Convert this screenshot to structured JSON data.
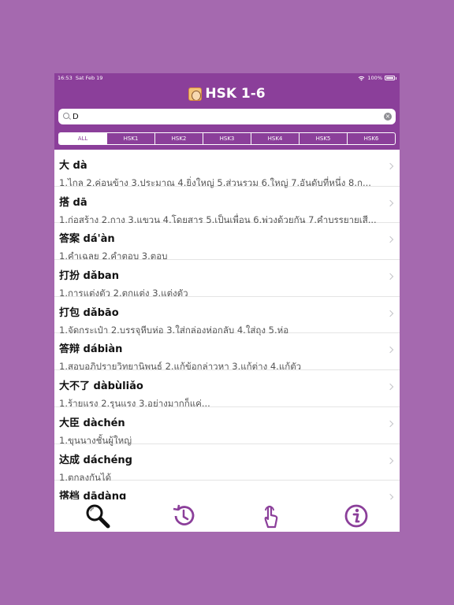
{
  "status_bar": {
    "time": "16:53",
    "date": "Sat Feb 19",
    "battery": "100%"
  },
  "header": {
    "title": "HSK 1-6"
  },
  "search": {
    "value": "D",
    "placeholder": ""
  },
  "segments": [
    "ALL",
    "HSK1",
    "HSK2",
    "HSK3",
    "HSK4",
    "HSK5",
    "HSK6"
  ],
  "selected_segment": "ALL",
  "words": [
    {
      "hanzi": "大",
      "pinyin": "dà",
      "meaning": "1.ไกล 2.ค่อนข้าง 3.ประมาณ 4.ยิ่งใหญ่ 5.ส่วนรวม 6.ใหญ่ 7.อันดับที่หนึ่ง 8.ก..."
    },
    {
      "hanzi": "搭",
      "pinyin": "dā",
      "meaning": "1.ก่อสร้าง 2.กาง 3.แขวน 4.โดยสาร 5.เป็นเพื่อน 6.พ่วงด้วยกัน 7.คำบรรยายเสี..."
    },
    {
      "hanzi": "答案",
      "pinyin": "dá'àn",
      "meaning": "1.คำเฉลย 2.คำตอบ 3.ตอบ"
    },
    {
      "hanzi": "打扮",
      "pinyin": "dǎban",
      "meaning": "1.การแต่งตัว 2.ตกแต่ง 3.แต่งตัว"
    },
    {
      "hanzi": "打包",
      "pinyin": "dǎbāo",
      "meaning": "1.จัดกระเป๋า 2.บรรจุหีบห่อ 3.ใส่กล่องห่อกลับ 4.ใส่ถุง 5.ห่อ"
    },
    {
      "hanzi": "答辩",
      "pinyin": "dábiàn",
      "meaning": "1.สอบอภิปรายวิทยานิพนธ์ 2.แก้ข้อกล่าวหา 3.แก้ต่าง 4.แก้ตัว"
    },
    {
      "hanzi": "大不了",
      "pinyin": "dàbùliǎo",
      "meaning": "1.ร้ายแรง 2.รุนแรง 3.อย่างมากก็แค่..."
    },
    {
      "hanzi": "大臣",
      "pinyin": "dàchén",
      "meaning": "1.ขุนนางชั้นผู้ใหญ่"
    },
    {
      "hanzi": "达成",
      "pinyin": "dáchéng",
      "meaning": "1.ตกลงกันได้"
    },
    {
      "hanzi": "搭档",
      "pinyin": "dādàng",
      "meaning": ""
    }
  ],
  "tabs": [
    {
      "name": "search",
      "icon": "magnifier-icon"
    },
    {
      "name": "history",
      "icon": "history-clock-icon"
    },
    {
      "name": "handwriting",
      "icon": "finger-tap-icon"
    },
    {
      "name": "info",
      "icon": "info-icon"
    }
  ],
  "colors": {
    "background": "#a569af",
    "header": "#8b3f9a",
    "accent": "#8b3f9a"
  }
}
